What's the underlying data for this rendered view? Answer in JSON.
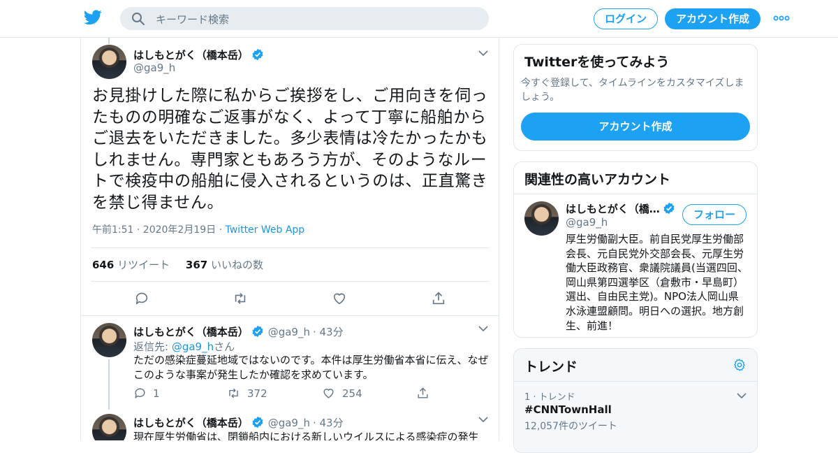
{
  "header": {
    "search_placeholder": "キーワード検索",
    "login_label": "ログイン",
    "signup_label": "アカウント作成"
  },
  "main_tweet": {
    "author_name": "はしもとがく（橋本岳）",
    "handle": "@ga9_h",
    "text": "お見掛けした際に私からご挨拶をし、ご用向きを伺ったものの明確なご返事がなく、よって丁寧に船舶からご退去をいただきました。多少表情は冷たかったかもしれません。専門家ともあろう方が、そのようなルートで検疫中の船舶に侵入されるというのは、正直驚きを禁じ得ません。",
    "time": "午前1:51 · 2020年2月19日",
    "sep": "·",
    "source": "Twitter Web App",
    "retweet_count": "646",
    "retweet_label": "リツイート",
    "like_count": "367",
    "like_label": "いいねの数"
  },
  "replies": [
    {
      "author_name": "はしもとがく（橋本岳）",
      "handle": "@ga9_h",
      "time": "· 43分",
      "reply_prefix": "返信先: ",
      "reply_to": "@ga9_h",
      "reply_suffix": "さん",
      "text": "ただの感染症蔓延地域ではないのです。本件は厚生労働省本省に伝え、なぜこのような事案が発生したか確認を求めています。",
      "reply_count": "1",
      "retweet_count": "372",
      "like_count": "254"
    },
    {
      "author_name": "はしもとがく（橋本岳）",
      "handle": "@ga9_h",
      "time": "· 43分",
      "text": "現在厚生労働省は、閉鎖船内における新しいウイルスによる感染症の発生"
    }
  ],
  "try_card": {
    "title": "Twitterを使ってみよう",
    "subtitle": "今すぐ登録して、タイムラインをカスタマイズしましょう。",
    "button_label": "アカウント作成"
  },
  "related_card": {
    "title": "関連性の高いアカウント",
    "name": "はしもとがく（橋…",
    "handle": "@ga9_h",
    "follow_label": "フォロー",
    "bio": "厚生労働副大臣。前自民党厚生労働部会長、元自民党外交部会長、元厚生労働大臣政務官、衆議院議員(当選四回、岡山県第四選挙区（倉敷市・早島町）選出、自由民主党)。NPO法人岡山県水泳連盟顧問。明日への選択。地方創生、前進！"
  },
  "trends_card": {
    "title": "トレンド",
    "items": [
      {
        "context": "1 · トレンド",
        "name": "#CNNTownHall",
        "count": "12,057件のツイート"
      }
    ]
  },
  "colors": {
    "accent": "#1da1f2",
    "link": "#1b95e0",
    "muted": "#657786",
    "text": "#14171a"
  },
  "icons": [
    "twitter-logo-icon",
    "search-icon",
    "more-icon",
    "verified-icon",
    "chevron-down-icon",
    "reply-icon",
    "retweet-icon",
    "like-icon",
    "share-icon",
    "settings-icon"
  ]
}
